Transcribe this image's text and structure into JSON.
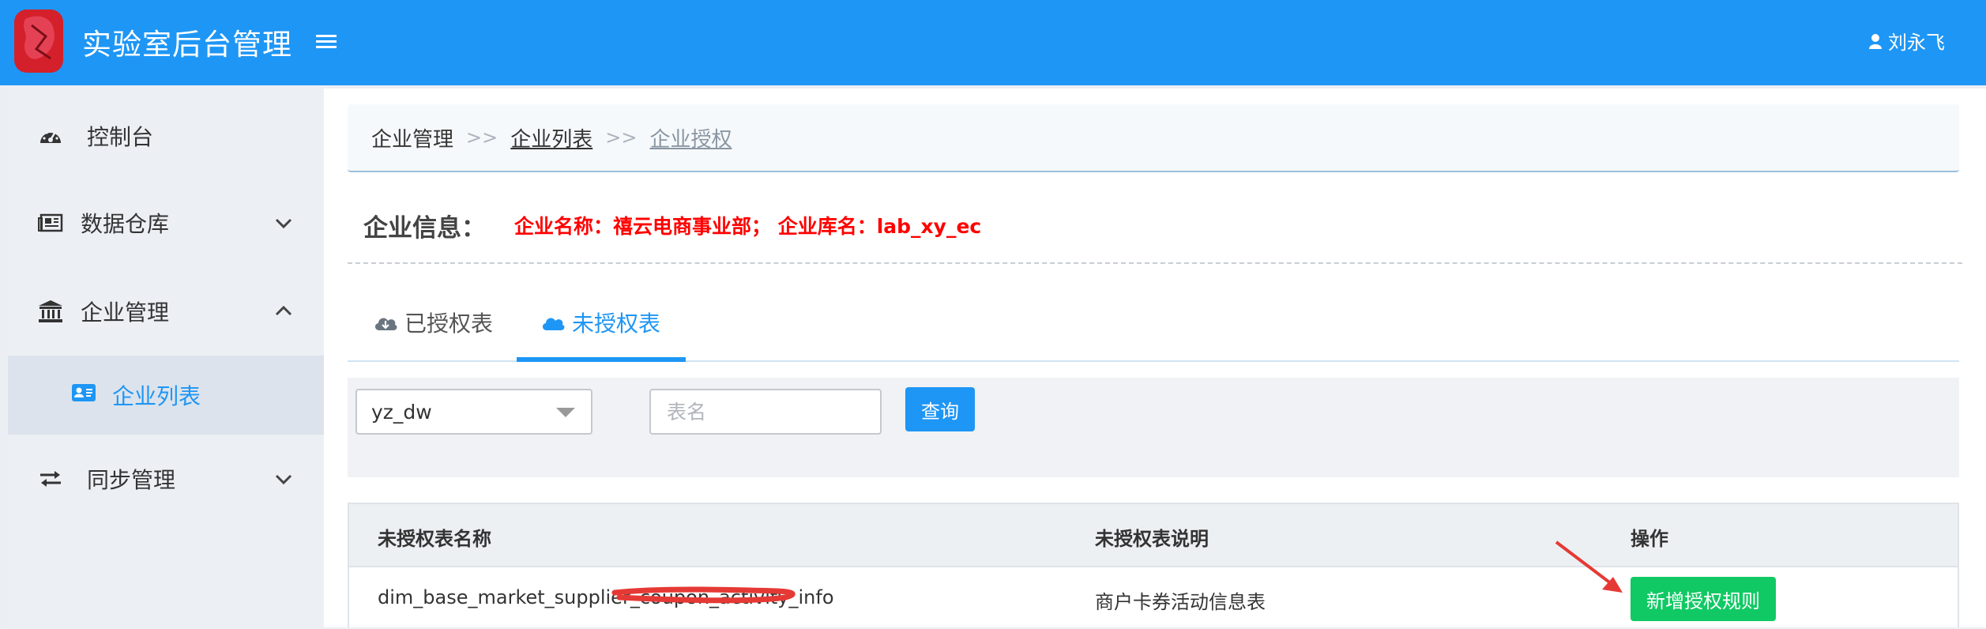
{
  "header": {
    "app_title": "实验室后台管理",
    "user_name": "刘永飞",
    "logo_icon": "app-logo-icon",
    "menu_icon": "hamburger-menu-icon",
    "user_icon": "user-icon",
    "brand_color": "#1e96f5"
  },
  "sidebar": {
    "items": [
      {
        "label": "控制台",
        "icon": "dashboard-icon"
      },
      {
        "label": "数据仓库",
        "icon": "newspaper-icon",
        "expandable": true
      },
      {
        "label": "企业管理",
        "icon": "bank-icon",
        "expanded": true
      },
      {
        "label": "企业列表",
        "icon": "id-card-icon",
        "active": true
      },
      {
        "label": "同步管理",
        "icon": "exchange-icon",
        "expandable": true
      }
    ]
  },
  "breadcrumb": {
    "items": [
      "企业管理",
      "企业列表",
      "企业授权"
    ],
    "separator": ">>"
  },
  "company_info": {
    "label": "企业信息：",
    "text": "企业名称：禧云电商事业部； 企业库名：lab_xy_ec"
  },
  "tabs": [
    {
      "label": "已授权表",
      "icon": "cloud-download-icon",
      "active": false
    },
    {
      "label": "未授权表",
      "icon": "cloud-icon",
      "active": true
    }
  ],
  "filter": {
    "db_select_value": "yz_dw",
    "table_name_placeholder": "表名",
    "query_label": "查询"
  },
  "table": {
    "headers": [
      "未授权表名称",
      "未授权表说明",
      "操作"
    ],
    "rows": [
      {
        "name": "dim_base_market_supplier_coupon_activity_info",
        "description": "商户卡券活动信息表",
        "action_label": "新增授权规则"
      }
    ]
  },
  "colors": {
    "accent": "#1e96f5",
    "success": "#11c964",
    "alert_text": "#ff0000",
    "annotation": "#e53935"
  }
}
